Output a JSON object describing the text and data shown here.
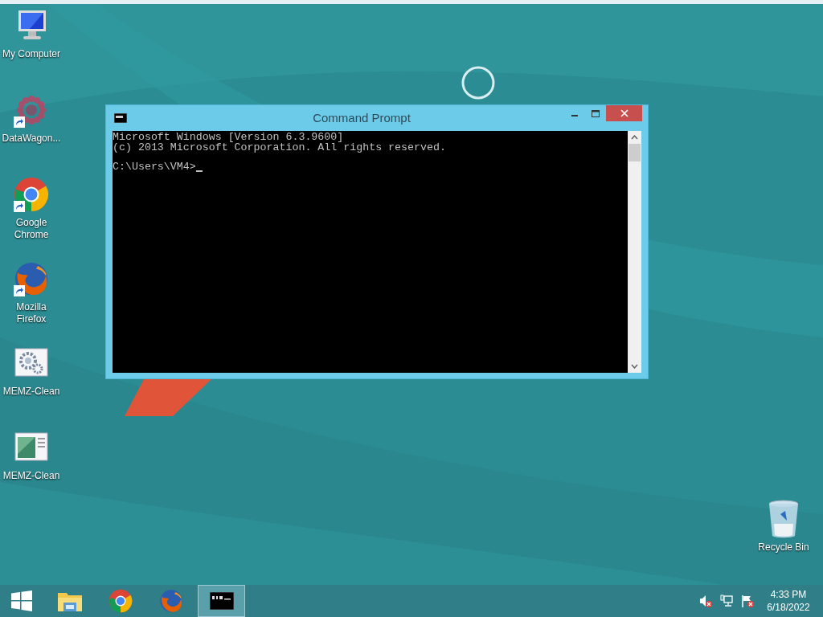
{
  "desktop_icons": [
    {
      "label": "My Computer",
      "kind": "computer",
      "shortcut": false
    },
    {
      "label": "DataWagon...",
      "kind": "datawagon",
      "shortcut": true
    },
    {
      "label": "Google Chrome",
      "kind": "chrome",
      "shortcut": true
    },
    {
      "label": "Mozilla Firefox",
      "kind": "firefox",
      "shortcut": true
    },
    {
      "label": "MEMZ-Clean",
      "kind": "gears",
      "shortcut": false
    },
    {
      "label": "MEMZ-Clean",
      "kind": "window",
      "shortcut": false
    }
  ],
  "recycle_bin": {
    "label": "Recycle Bin"
  },
  "window": {
    "title": "Command Prompt",
    "lines": [
      "Microsoft Windows [Version 6.3.9600]",
      "(c) 2013 Microsoft Corporation. All rights reserved."
    ],
    "prompt": "C:\\Users\\VM4>"
  },
  "taskbar": {
    "items": [
      {
        "kind": "start",
        "selected": false
      },
      {
        "kind": "explorer",
        "selected": false
      },
      {
        "kind": "chrome",
        "selected": false
      },
      {
        "kind": "firefox",
        "selected": false
      },
      {
        "kind": "cmd",
        "selected": true
      }
    ],
    "tray": [
      {
        "kind": "speaker"
      },
      {
        "kind": "network"
      },
      {
        "kind": "flag"
      }
    ],
    "time": "4:33 PM",
    "date": "6/18/2022"
  }
}
